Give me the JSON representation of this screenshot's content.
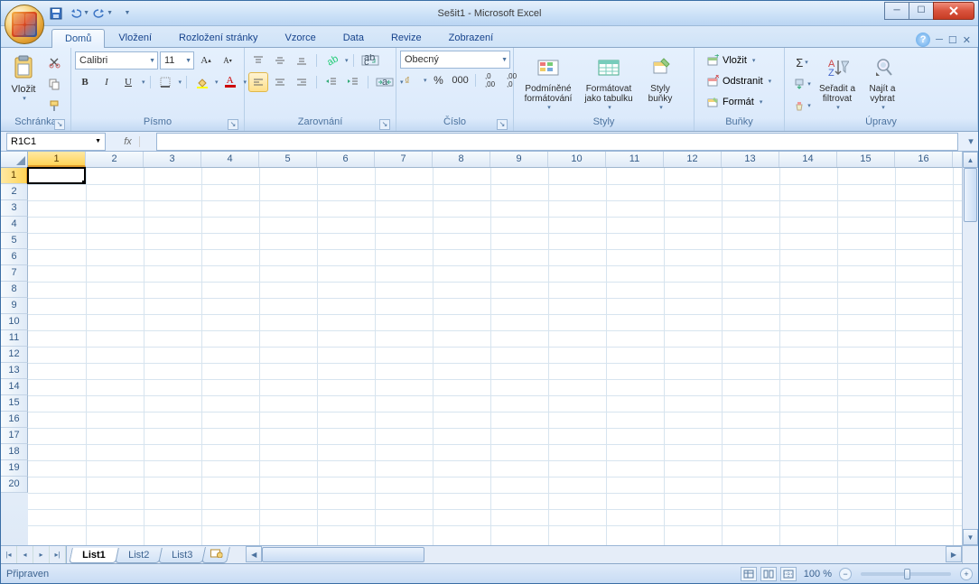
{
  "title": "Sešit1 - Microsoft Excel",
  "tabs": {
    "home": "Domů",
    "insert": "Vložení",
    "layout": "Rozložení stránky",
    "formulas": "Vzorce",
    "data": "Data",
    "review": "Revize",
    "view": "Zobrazení"
  },
  "ribbon": {
    "clipboard": {
      "label": "Schránka",
      "paste": "Vložit"
    },
    "font": {
      "label": "Písmo",
      "name": "Calibri",
      "size": "11",
      "bold": "B",
      "italic": "I",
      "underline": "U"
    },
    "align": {
      "label": "Zarovnání"
    },
    "number": {
      "label": "Číslo",
      "format": "Obecný"
    },
    "styles": {
      "label": "Styly",
      "cond": "Podmíněné\nformátování",
      "table": "Formátovat\njako tabulku",
      "cell": "Styly\nbuňky"
    },
    "cells": {
      "label": "Buňky",
      "insert": "Vložit",
      "delete": "Odstranit",
      "format": "Formát"
    },
    "editing": {
      "label": "Úpravy",
      "sort": "Seřadit a\nfiltrovat",
      "find": "Najít a\nvybrat"
    }
  },
  "namebox": "R1C1",
  "columns": [
    "1",
    "2",
    "3",
    "4",
    "5",
    "6",
    "7",
    "8",
    "9",
    "10",
    "11",
    "12",
    "13",
    "14",
    "15",
    "16"
  ],
  "rows": [
    "1",
    "2",
    "3",
    "4",
    "5",
    "6",
    "7",
    "8",
    "9",
    "10",
    "11",
    "12",
    "13",
    "14",
    "15",
    "16",
    "17",
    "18",
    "19",
    "20"
  ],
  "sheets": {
    "s1": "List1",
    "s2": "List2",
    "s3": "List3"
  },
  "status": {
    "ready": "Připraven",
    "zoom": "100 %"
  }
}
